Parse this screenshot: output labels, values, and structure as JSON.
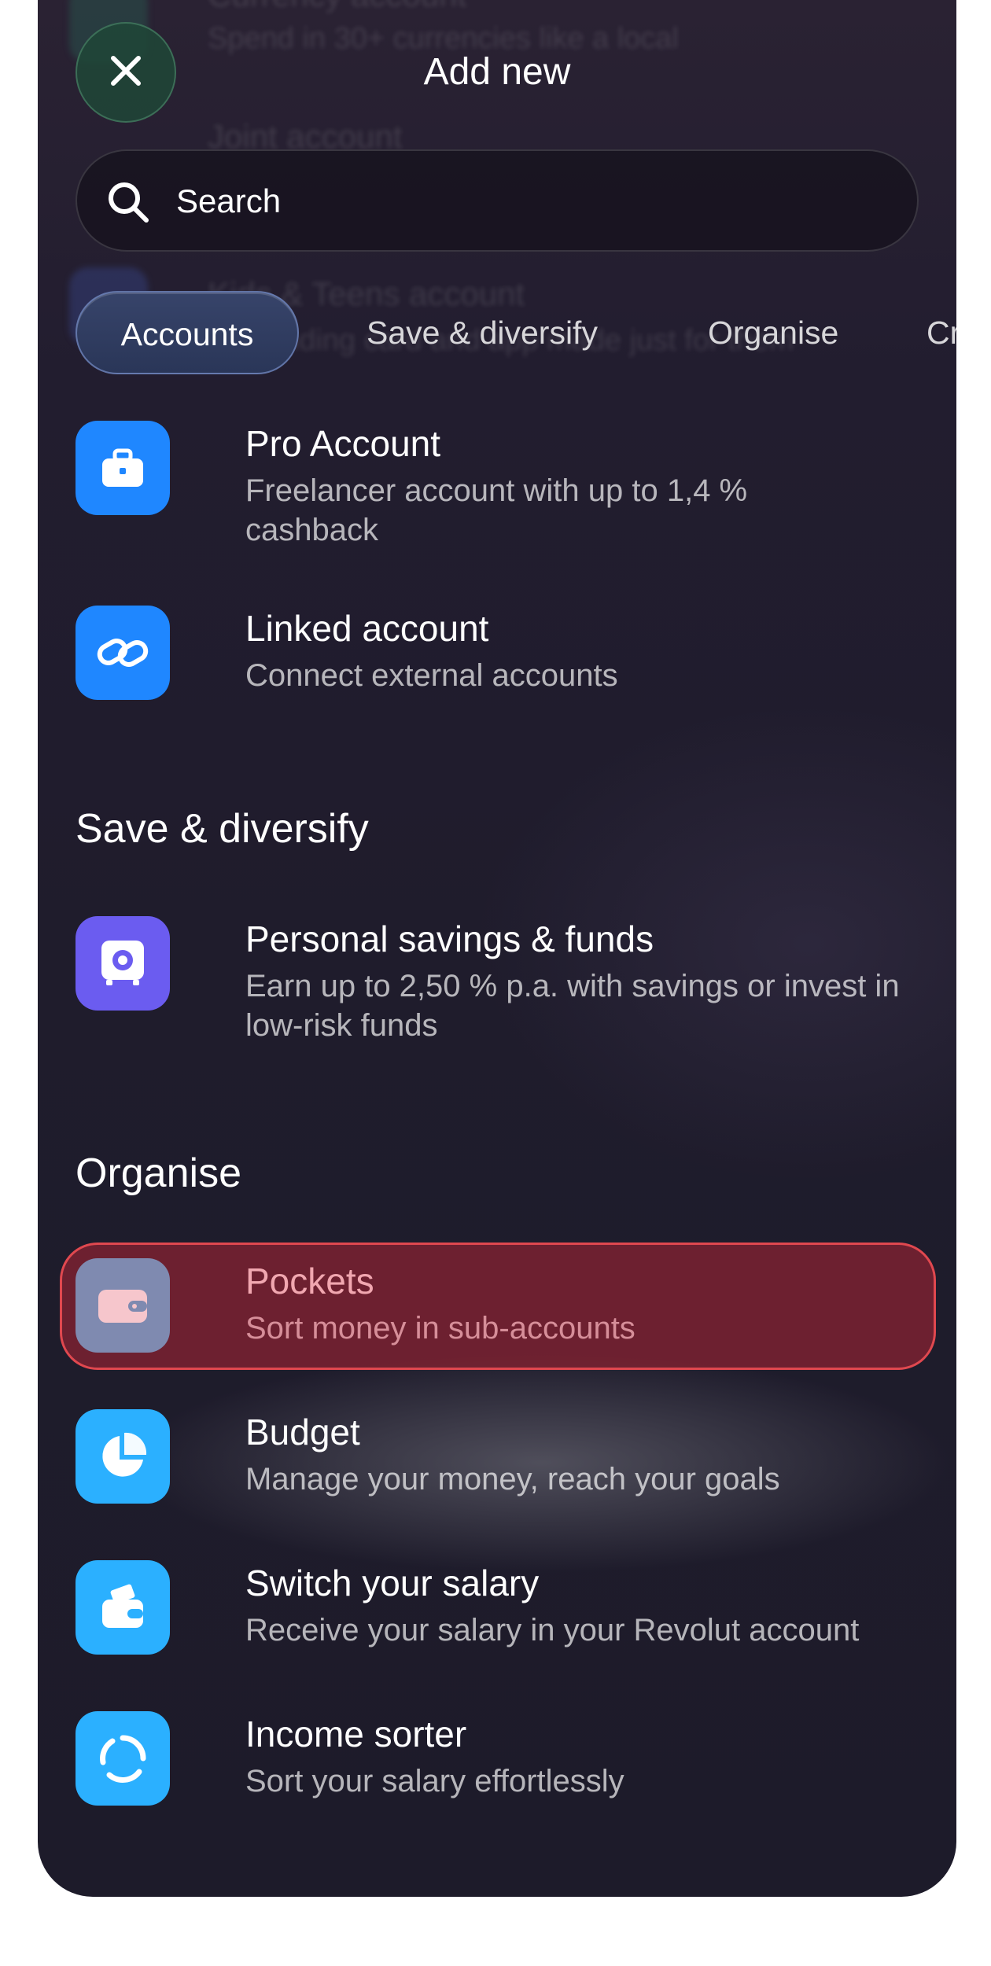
{
  "header": {
    "title": "Add new",
    "close_label": "Close"
  },
  "search": {
    "placeholder": "Search"
  },
  "tabs": [
    {
      "label": "Accounts",
      "active": true
    },
    {
      "label": "Save & diversify",
      "active": false
    },
    {
      "label": "Organise",
      "active": false
    },
    {
      "label": "Cred",
      "active": false
    }
  ],
  "background_ghost": {
    "item1_title": "Currency account",
    "item1_sub": "Spend in 30+ currencies like a local",
    "item2_title": "Joint account",
    "item3_title": "Kids & Teens account",
    "item3_sub": "A spending card and app made just for them"
  },
  "accounts": {
    "items": [
      {
        "title": "Pro Account",
        "subtitle": "Freelancer account with up to 1,4 % cashback",
        "icon": "briefcase-icon",
        "color": "#1f87ff"
      },
      {
        "title": "Linked account",
        "subtitle": "Connect external accounts",
        "icon": "link-icon",
        "color": "#1f87ff"
      }
    ]
  },
  "save_diversify": {
    "heading": "Save & diversify",
    "items": [
      {
        "title": "Personal savings & funds",
        "subtitle": "Earn up to 2,50 % p.a. with savings or invest in low-risk funds",
        "icon": "safe-icon",
        "color": "#6b5cf0"
      }
    ]
  },
  "organise": {
    "heading": "Organise",
    "items": [
      {
        "title": "Pockets",
        "subtitle": "Sort money in sub-accounts",
        "icon": "wallet-icon",
        "color": "#7f8ab0",
        "highlighted": true
      },
      {
        "title": "Budget",
        "subtitle": "Manage your money, reach your goals",
        "icon": "pie-chart-icon",
        "color": "#2bb0ff"
      },
      {
        "title": "Switch your salary",
        "subtitle": "Receive your salary in your Revolut account",
        "icon": "salary-wallet-icon",
        "color": "#2bb0ff"
      },
      {
        "title": "Income sorter",
        "subtitle": "Sort your salary effortlessly",
        "icon": "circular-arrows-icon",
        "color": "#2bb0ff"
      }
    ]
  },
  "colors": {
    "highlight_fill": "#8c2332",
    "highlight_border": "#e0484f",
    "active_tab": "#2f3c60"
  }
}
